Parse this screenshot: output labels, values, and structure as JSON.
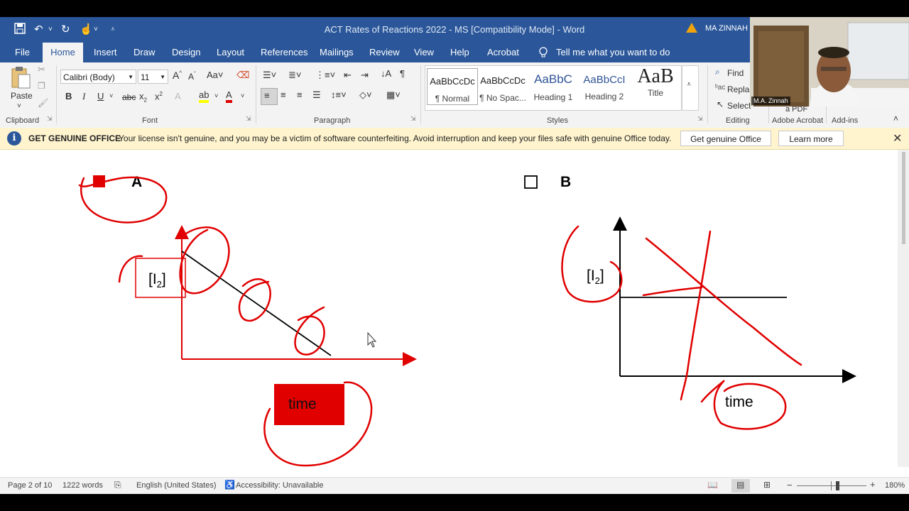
{
  "titlebar": {
    "document_title": "ACT Rates of Reactions 2022 - MS [Compatibility Mode]  -  Word",
    "user_name": "MA ZINNAH"
  },
  "tabs": [
    "File",
    "Home",
    "Insert",
    "Draw",
    "Design",
    "Layout",
    "References",
    "Mailings",
    "Review",
    "View",
    "Help",
    "Acrobat"
  ],
  "tell_me": "Tell me what you want to do",
  "ribbon": {
    "clipboard": {
      "paste": "Paste",
      "label": "Clipboard"
    },
    "font": {
      "name": "Calibri (Body)",
      "size": "11",
      "label": "Font"
    },
    "paragraph": {
      "label": "Paragraph"
    },
    "styles": {
      "label": "Styles",
      "items": [
        {
          "sample": "AaBbCcDc",
          "name": "¶ Normal"
        },
        {
          "sample": "AaBbCcDc",
          "name": "¶ No Spac..."
        },
        {
          "sample": "AaBbC",
          "name": "Heading 1"
        },
        {
          "sample": "AaBbCcI",
          "name": "Heading 2"
        },
        {
          "sample": "AaB",
          "name": "Title"
        }
      ]
    },
    "editing": {
      "find": "Find",
      "replace": "Replac",
      "select": "Select",
      "label": "Editing"
    },
    "acrobat": {
      "text": "a PDF",
      "label": "Adobe Acrobat"
    },
    "addins": {
      "label": "Add-ins"
    }
  },
  "notice": {
    "title": "GET GENUINE OFFICE",
    "message": "Your license isn't genuine, and you may be a victim of software counterfeiting. Avoid interruption and keep your files safe with genuine Office today.",
    "primary_button": "Get genuine Office",
    "secondary_button": "Learn more"
  },
  "document": {
    "option_a": {
      "label": "A",
      "y_axis": "[I",
      "y_sub": "2",
      "y_close": "]",
      "x_axis": "time"
    },
    "option_b": {
      "label": "B",
      "y_axis": "[I",
      "y_sub": "2",
      "y_close": "]",
      "x_axis": "time"
    }
  },
  "status": {
    "page": "Page 2 of 10",
    "words": "1222 words",
    "language": "English (United States)",
    "accessibility": "Accessibility: Unavailable",
    "zoom": "180%"
  },
  "webcam": {
    "name": "M.A. Zinnah"
  },
  "colors": {
    "word_blue": "#2b579a",
    "annotation_red": "#e00000",
    "notice_bg": "#fff4ce"
  }
}
